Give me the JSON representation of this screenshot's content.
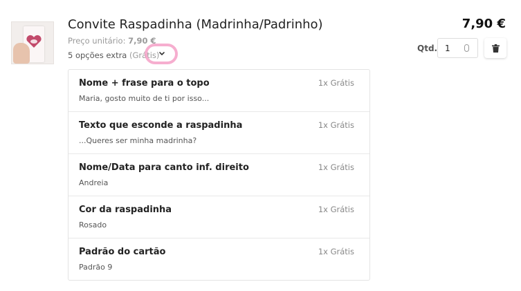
{
  "product": {
    "title": "Convite Raspadinha (Madrinha/Padrinho)",
    "unit_price_label": "Preço unitário:",
    "unit_price_value": "7,90 €",
    "extras_label": "5 opções extra",
    "extras_note": "(Grátis)",
    "total_price": "7,90 €",
    "quantity_label": "Qtd.",
    "quantity_value": "1"
  },
  "icons": {
    "toggle": "chevron-down-icon",
    "delete": "trash-icon",
    "highlight_color": "#f4a0c7"
  },
  "options": [
    {
      "name": "Nome + frase para o topo",
      "value": "Maria, gosto muito de ti por isso...",
      "qty": "1x Grátis"
    },
    {
      "name": "Texto que esconde a raspadinha",
      "value": "...Queres ser minha madrinha?",
      "qty": "1x Grátis"
    },
    {
      "name": "Nome/Data para canto inf. direito",
      "value": "Andreia",
      "qty": "1x Grátis"
    },
    {
      "name": "Cor da raspadinha",
      "value": "Rosado",
      "qty": "1x Grátis"
    },
    {
      "name": "Padrão do cartão",
      "value": "Padrão 9",
      "qty": "1x Grátis"
    }
  ]
}
